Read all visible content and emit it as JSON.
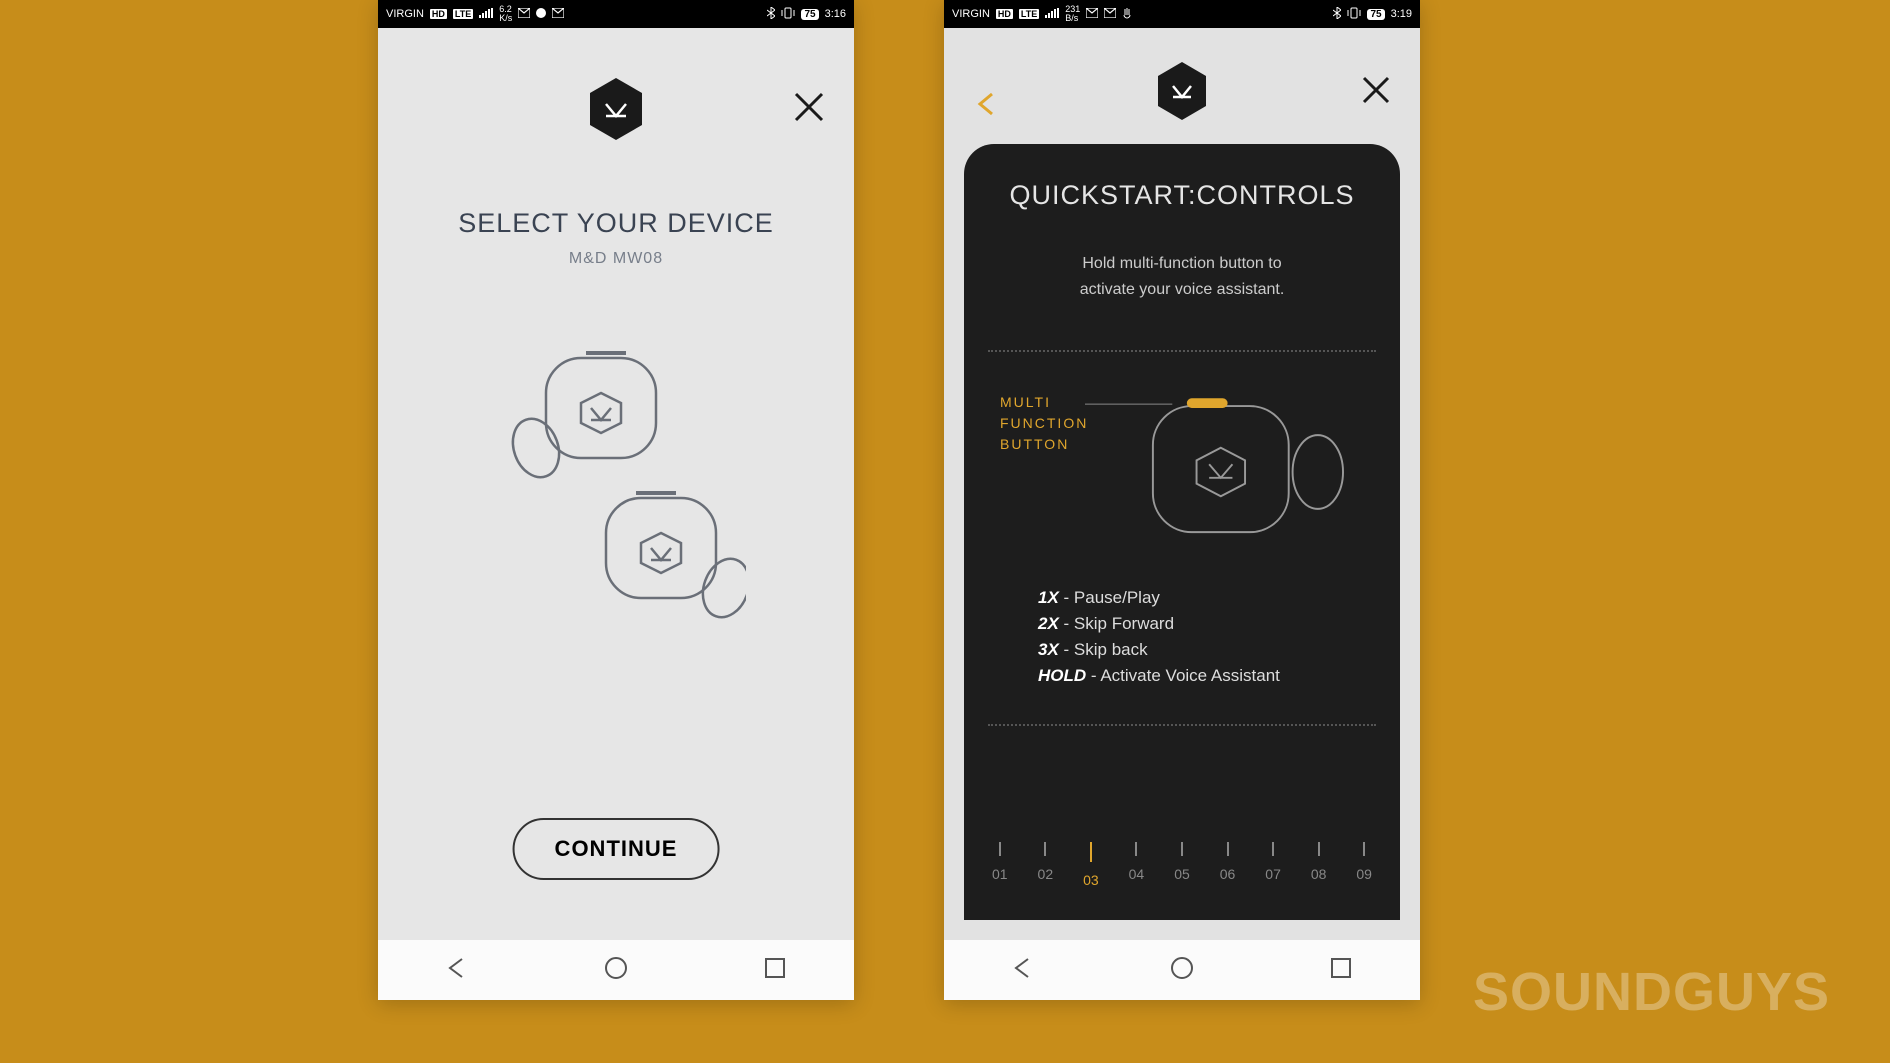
{
  "watermark": "SOUNDGUYS",
  "left": {
    "status": {
      "carrier": "VIRGIN",
      "hd_badge": "HD",
      "net_badge": "LTE",
      "speed_value": "6.2",
      "speed_unit": "K/s",
      "battery": "75",
      "time": "3:16"
    },
    "title": "SELECT YOUR DEVICE",
    "subtitle": "M&D MW08",
    "continue_label": "CONTINUE"
  },
  "right": {
    "status": {
      "carrier": "VIRGIN",
      "hd_badge": "HD",
      "net_badge": "LTE",
      "speed_value": "231",
      "speed_unit": "B/s",
      "battery": "75",
      "time": "3:19"
    },
    "card": {
      "title": "QUICKSTART:CONTROLS",
      "description_line1": "Hold multi-function button to",
      "description_line2": "activate your voice assistant.",
      "mfb_label_l1": "MULTI",
      "mfb_label_l2": "FUNCTION",
      "mfb_label_l3": "BUTTON",
      "controls": [
        {
          "key": "1X",
          "action": "Pause/Play"
        },
        {
          "key": "2X",
          "action": "Skip Forward"
        },
        {
          "key": "3X",
          "action": "Skip back"
        },
        {
          "key": "HOLD",
          "action": "Activate Voice Assistant"
        }
      ],
      "pages": [
        "01",
        "02",
        "03",
        "04",
        "05",
        "06",
        "07",
        "08",
        "09"
      ],
      "active_page": "03"
    }
  }
}
